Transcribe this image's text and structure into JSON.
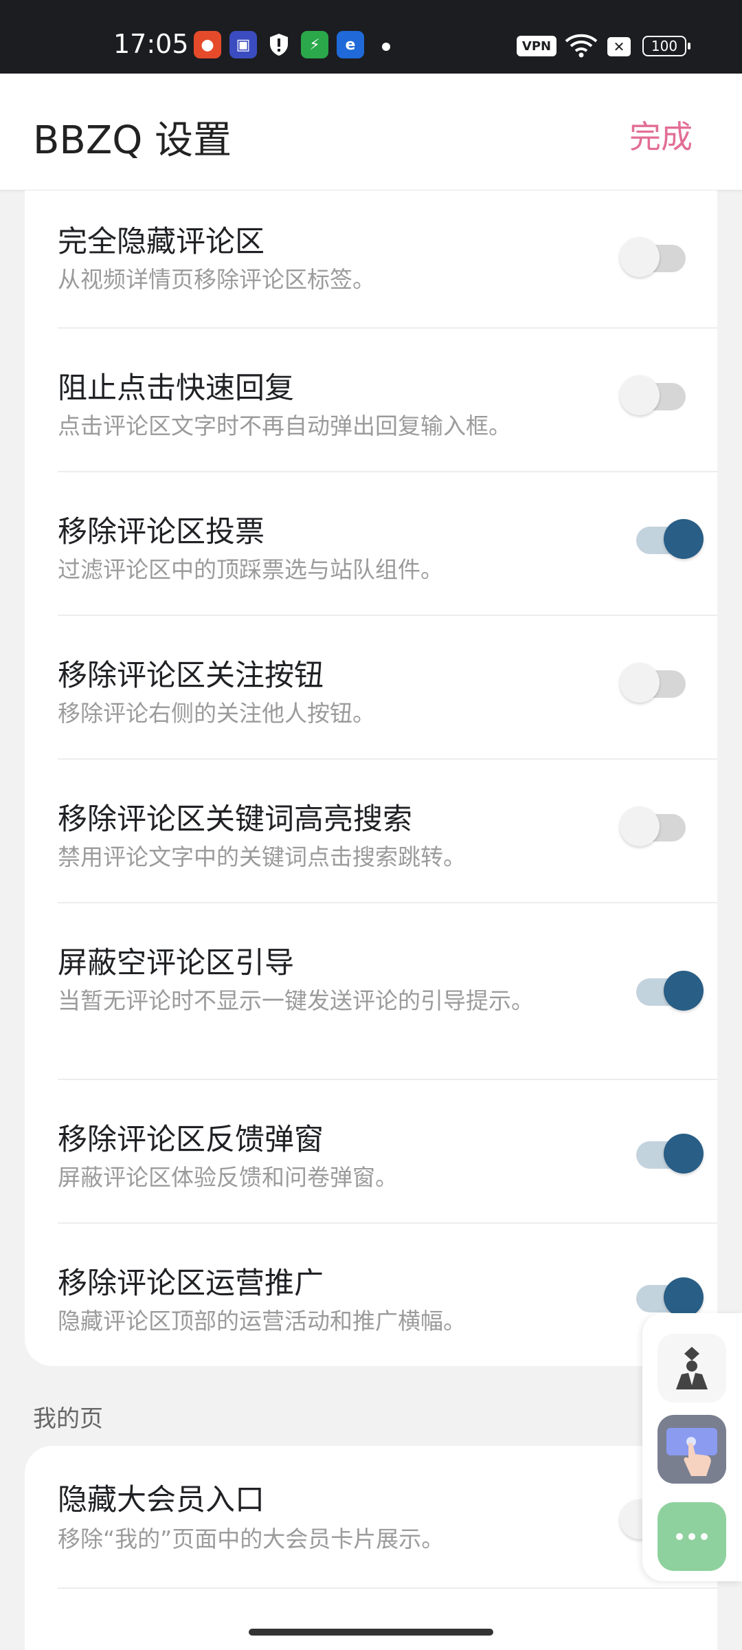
{
  "status_bar": {
    "time": "17:05",
    "vpn": "VPN",
    "battery": "100",
    "notification_icons": [
      "taobao-icon",
      "tieba-icon",
      "shield-icon",
      "security-icon",
      "browser-icon"
    ]
  },
  "header": {
    "title": "BBZQ 设置",
    "done_label": "完成",
    "accent_color": "#e26e95"
  },
  "settings": [
    {
      "title": "完全隐藏评论区",
      "desc": "从视频详情页移除评论区标签。",
      "on": false
    },
    {
      "title": "阻止点击快速回复",
      "desc": "点击评论区文字时不再自动弹出回复输入框。",
      "on": false
    },
    {
      "title": "移除评论区投票",
      "desc": "过滤评论区中的顶踩票选与站队组件。",
      "on": true
    },
    {
      "title": "移除评论区关注按钮",
      "desc": "移除评论右侧的关注他人按钮。",
      "on": false
    },
    {
      "title": "移除评论区关键词高亮搜索",
      "desc": "禁用评论文字中的关键词点击搜索跳转。",
      "on": false
    },
    {
      "title": "屏蔽空评论区引导",
      "desc": "当暂无评论时不显示一键发送评论的引导提示。",
      "on": true
    },
    {
      "title": "移除评论区反馈弹窗",
      "desc": "屏蔽评论区体验反馈和问卷弹窗。",
      "on": true
    },
    {
      "title": "移除评论区运营推广",
      "desc": "隐藏评论区顶部的运营活动和推广横幅。",
      "on": true
    }
  ],
  "section_my": {
    "label": "我的页",
    "items": [
      {
        "title": "隐藏大会员入口",
        "desc": "移除“我的”页面中的大会员卡片展示。",
        "on": false
      }
    ]
  },
  "toggle_colors": {
    "on_thumb": "#295e86",
    "on_track": "#c3d3de",
    "off_thumb": "#f2f2f2",
    "off_track": "#d6d6d6"
  }
}
